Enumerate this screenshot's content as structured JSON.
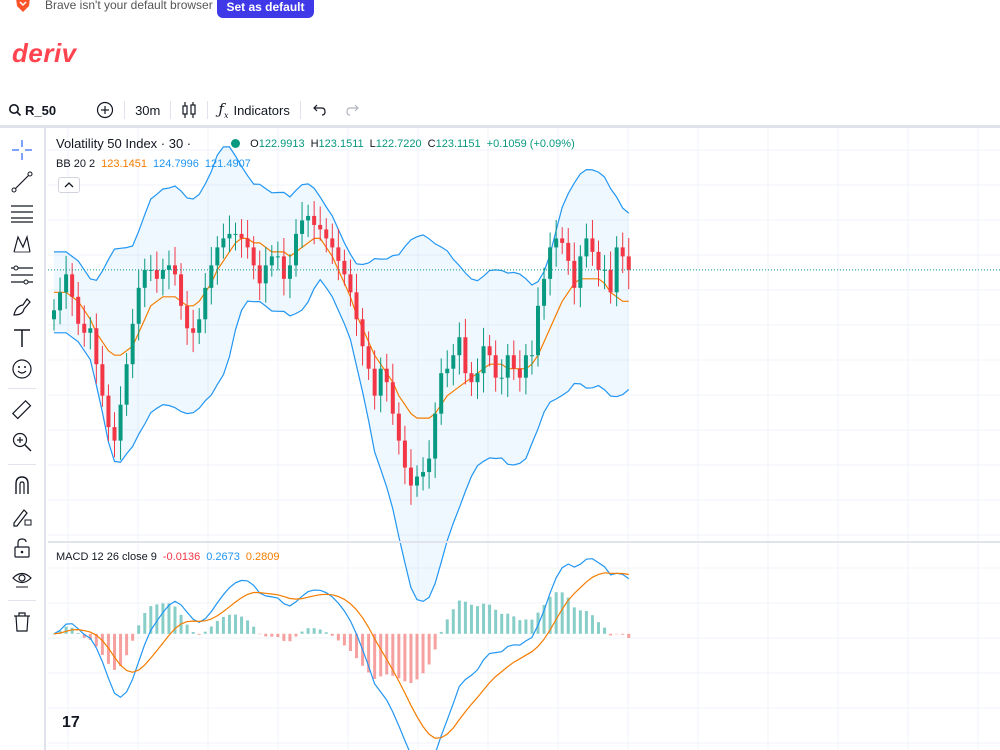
{
  "browser_bar": {
    "message": "Brave isn't your default browser",
    "set_default_label": "Set as default"
  },
  "brand": {
    "logo_text": "deriv",
    "accent_color": "#ff444f"
  },
  "toolbar": {
    "symbol": "R_50",
    "interval": "30m",
    "indicators_label": "Indicators"
  },
  "left_tools": [
    "crosshair-icon",
    "trend-line-icon",
    "parallel-channel-icon",
    "pattern-icon",
    "fib-icon",
    "brush-icon",
    "text-icon",
    "emoji-icon",
    "ruler-icon",
    "zoom-in-icon",
    "magnet-icon",
    "lock-drawing-icon",
    "unlock-icon",
    "eye-icon",
    "trash-icon"
  ],
  "legend": {
    "title": "Volatility 50 Index · 30 ·",
    "o_label": "O",
    "o_value": "122.9913",
    "h_label": "H",
    "h_value": "123.1511",
    "l_label": "L",
    "l_value": "122.7220",
    "c_label": "C",
    "c_value": "123.1151",
    "change": "+0.1059 (+0.09%)",
    "up_color": "#089981"
  },
  "bb_legend": {
    "label": "BB 20 2",
    "basis": "123.1451",
    "upper": "124.7996",
    "lower": "121.4907",
    "basis_color": "#f57c00",
    "band_color": "#2196f3"
  },
  "macd_legend": {
    "label": "MACD 12 26 close 9",
    "hist": "-0.0136",
    "macd": "0.2673",
    "signal": "0.2809",
    "hist_color": "#f23645",
    "macd_color": "#2196f3",
    "signal_color": "#f57c00"
  },
  "tv_logo": "17",
  "chart_data": {
    "type": "line",
    "x": [
      0,
      1,
      2,
      3,
      4,
      5,
      6,
      7,
      8,
      9,
      10,
      11,
      12,
      13,
      14,
      15,
      16,
      17,
      18,
      19,
      20,
      21,
      22,
      23,
      24,
      25,
      26,
      27,
      28,
      29,
      30,
      31,
      32,
      33,
      34,
      35,
      36,
      37,
      38,
      39,
      40,
      41,
      42,
      43,
      44,
      45,
      46,
      47,
      48,
      49,
      50,
      51,
      52,
      53,
      54,
      55,
      56,
      57,
      58,
      59,
      60,
      61,
      62,
      63,
      64,
      65,
      66,
      67,
      68,
      69,
      70,
      71,
      72,
      73,
      74,
      75,
      76,
      77,
      78,
      79,
      80,
      81,
      82,
      83,
      84,
      85,
      86,
      87,
      88,
      89,
      90,
      91,
      92,
      93,
      94,
      95
    ],
    "series": [
      {
        "values": [
          122.9,
          123.3,
          123.7,
          123.2,
          122.6,
          122.4,
          122.5,
          121.7,
          121.0,
          120.3,
          120.0,
          120.8,
          121.7,
          122.6,
          123.4,
          123.8,
          123.8,
          123.6,
          123.8,
          123.9,
          123.7,
          123.0,
          122.5,
          122.4,
          122.7,
          123.4,
          123.9,
          124.3,
          124.5,
          124.6,
          124.6,
          124.5,
          124.3,
          123.9,
          123.5,
          123.9,
          124.1,
          124.1,
          123.6,
          123.9,
          124.6,
          124.9,
          125.0,
          124.8,
          124.7,
          124.5,
          124.3,
          124.0,
          123.7,
          123.3,
          122.7,
          122.1,
          121.6,
          121.0,
          121.6,
          121.3,
          120.6,
          120.0,
          119.4,
          119.0,
          119.2,
          119.3,
          119.6,
          120.6,
          121.5,
          121.6,
          121.9,
          122.3,
          121.5,
          121.3,
          121.5,
          122.1,
          121.9,
          121.4,
          121.4,
          121.9,
          121.6,
          121.4,
          121.9,
          121.9,
          123.0,
          123.6,
          124.3,
          124.5,
          124.4,
          124.0,
          123.4,
          124.1,
          124.5,
          124.2,
          123.8,
          123.8,
          123.3,
          124.3,
          124.1,
          123.8
        ]
      },
      {
        "values": [
          123.3,
          123.3,
          123.3,
          123.2,
          123.1,
          122.9,
          122.7,
          122.4,
          122.2,
          122.0,
          121.9,
          121.9,
          122.0,
          122.1,
          122.4,
          122.7,
          123.0,
          123.1,
          123.2,
          123.2,
          123.2,
          123.1,
          123.0,
          123.0,
          123.1,
          123.3,
          123.5,
          123.8,
          124.0,
          124.2,
          124.4,
          124.5,
          124.5,
          124.4,
          124.4,
          124.3,
          124.2,
          124.2,
          124.2,
          124.1,
          124.2,
          124.3,
          124.4,
          124.5,
          124.5,
          124.3,
          124.1,
          123.8,
          123.5,
          123.2,
          122.8,
          122.5,
          122.2,
          121.9,
          121.7,
          121.5,
          121.3,
          121.0,
          120.8,
          120.6,
          120.5,
          120.5,
          120.5,
          120.6,
          120.8,
          121.0,
          121.1,
          121.2,
          121.3,
          121.4,
          121.5,
          121.6,
          121.7,
          121.7,
          121.7,
          121.6,
          121.6,
          121.6,
          121.6,
          121.7,
          121.9,
          122.2,
          122.5,
          122.8,
          123.1,
          123.3,
          123.5,
          123.6,
          123.6,
          123.6,
          123.6,
          123.5,
          123.3,
          123.2,
          123.1,
          123.1
        ]
      }
    ],
    "ylim": [
      118.5,
      125.8
    ],
    "macd_range": [
      -0.95,
      0.6
    ]
  }
}
